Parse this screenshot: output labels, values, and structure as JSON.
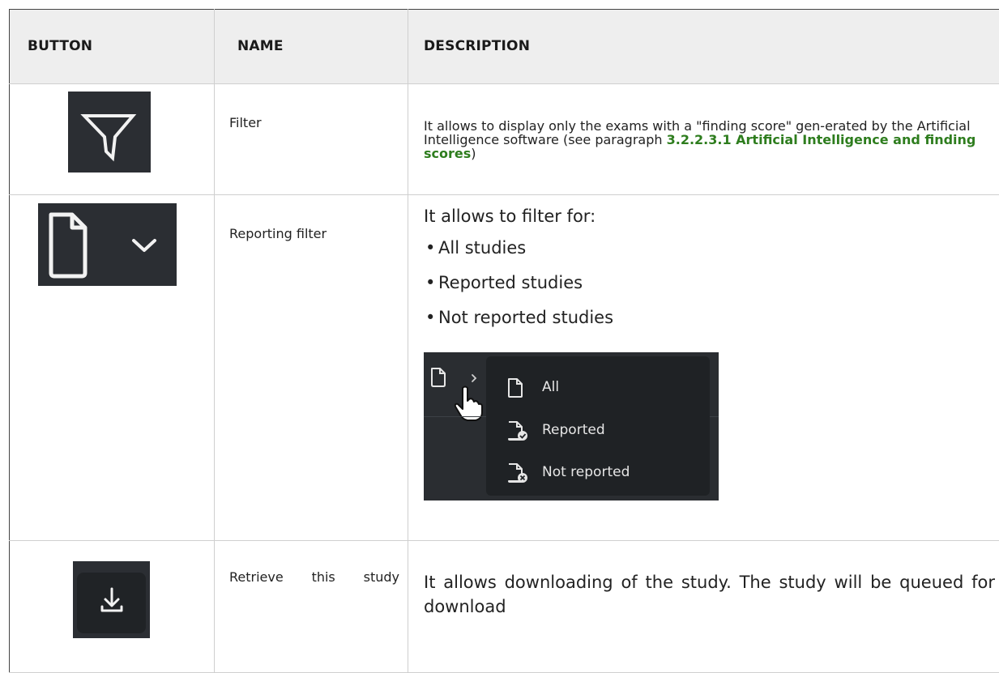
{
  "table": {
    "headers": [
      "BUTTON",
      "NAME",
      "DESCRIPTION"
    ],
    "rows": [
      {
        "icon": "filter-funnel-icon",
        "name": "Filter",
        "desc_pre": "It allows to display only the exams with a \"finding score\" gen-erated by the Artificial Intelligence software (see paragraph",
        "desc_link": "3.2.2.3.1 Artificial Intelligence and finding scores",
        "desc_post": ")"
      },
      {
        "icon": "document-dropdown-icon",
        "name": "Reporting filter",
        "intro": "It allows to filter for:",
        "items": [
          "All studies",
          "Reported studies",
          "Not reported studies"
        ],
        "menu": {
          "options": [
            "All",
            "Reported",
            "Not reported"
          ],
          "icons": [
            "document-icon",
            "document-check-icon",
            "document-x-icon"
          ]
        }
      },
      {
        "icon": "download-icon",
        "name": "Retrieve this study",
        "desc": "It allows downloading of the study. The study will be queued for download"
      }
    ]
  }
}
